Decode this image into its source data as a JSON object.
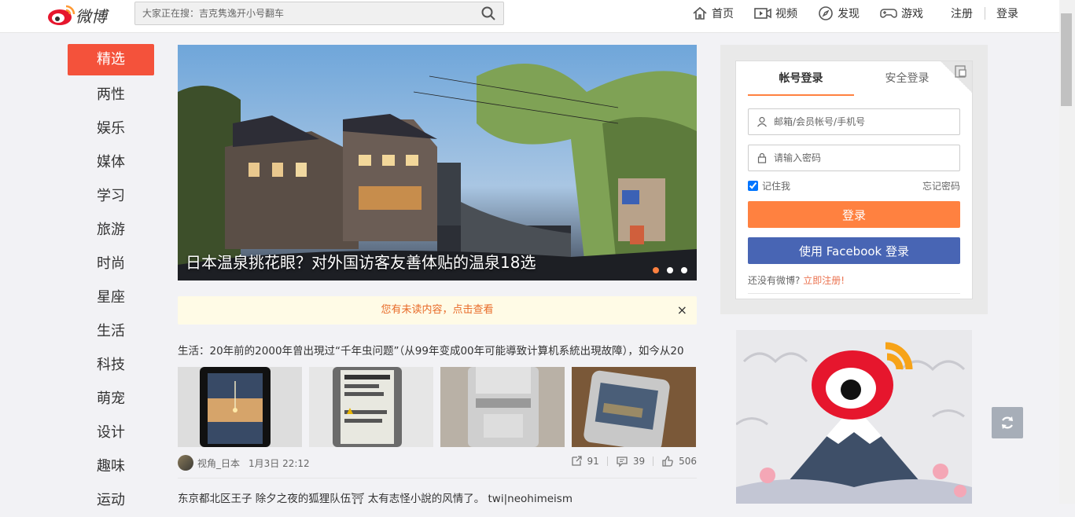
{
  "header": {
    "logo_text": "微博",
    "search_placeholder": "大家正在搜：吉克隽逸开小号翻车",
    "nav": [
      {
        "label": "首页",
        "icon": "home-icon"
      },
      {
        "label": "视频",
        "icon": "video-icon"
      },
      {
        "label": "发现",
        "icon": "compass-icon"
      },
      {
        "label": "游戏",
        "icon": "gamepad-icon"
      }
    ],
    "register": "注册",
    "login": "登录"
  },
  "sidebar": {
    "items": [
      {
        "label": "精选",
        "active": true
      },
      {
        "label": "两性"
      },
      {
        "label": "娱乐"
      },
      {
        "label": "媒体"
      },
      {
        "label": "学习"
      },
      {
        "label": "旅游"
      },
      {
        "label": "时尚"
      },
      {
        "label": "星座"
      },
      {
        "label": "生活"
      },
      {
        "label": "科技"
      },
      {
        "label": "萌宠"
      },
      {
        "label": "设计"
      },
      {
        "label": "趣味"
      },
      {
        "label": "运动"
      }
    ]
  },
  "hero": {
    "caption": "日本温泉挑花眼？对外国访客友善体贴的温泉18选",
    "slides": 3,
    "active_slide": 1
  },
  "notice": {
    "text": "您有未读内容，点击查看",
    "close": "×"
  },
  "post": {
    "text": "生活：20年前的2000年曾出現过“千年虫问题”（从99年变成00年可能導致计算机系統出現故障），如今从20",
    "author": "视角_日本",
    "time": "1月3日 22:12",
    "reposts": "91",
    "comments": "39",
    "likes": "506"
  },
  "post2": {
    "text": "东京都北区王子 除夕之夜的狐狸队伍⛩ 太有志怪小說的风情了。 twi|neohimeism"
  },
  "login": {
    "tab_account": "帐号登录",
    "tab_secure": "安全登录",
    "username_placeholder": "邮箱/会员帐号/手机号",
    "password_placeholder": "请输入密码",
    "remember": "记住我",
    "forgot": "忘记密码",
    "login_button": "登录",
    "facebook_button": "使用 Facebook 登录",
    "no_account": "还没有微博?",
    "register_now": "立即注册!"
  },
  "colors": {
    "accent": "#ff8140",
    "active_tag": "#f4523b",
    "facebook": "#4865b4"
  }
}
